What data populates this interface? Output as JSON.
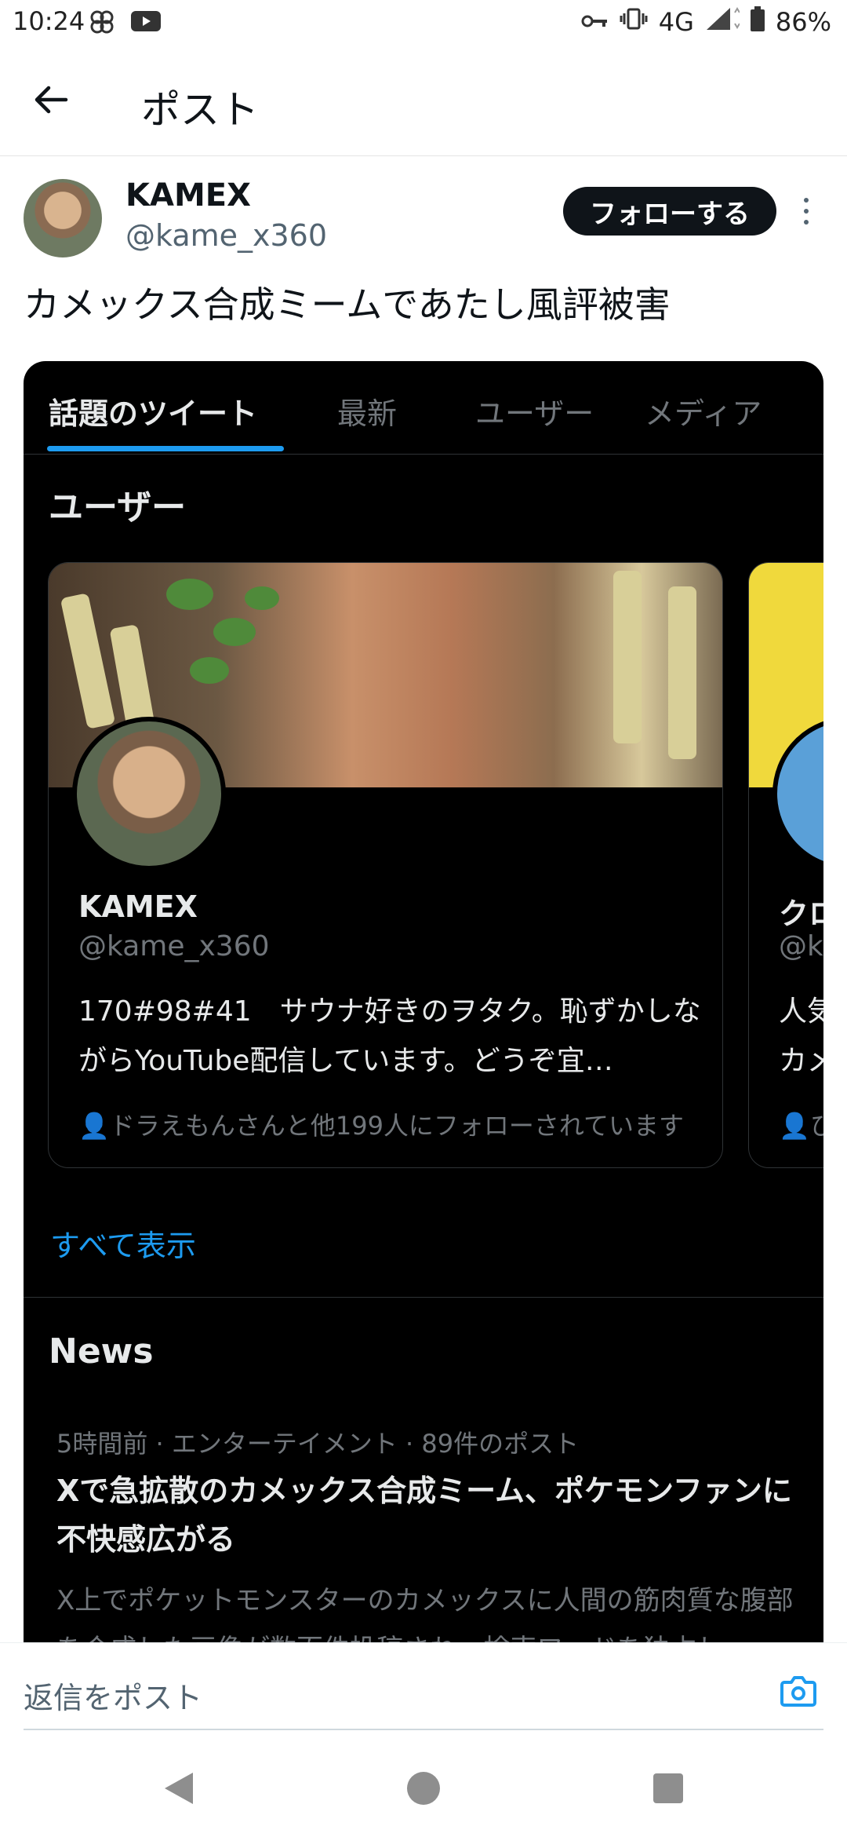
{
  "status_bar": {
    "time": "10:24",
    "network": "4G",
    "battery": "86%"
  },
  "header": {
    "title": "ポスト"
  },
  "post": {
    "author_name": "KAMEX",
    "author_handle": "@kame_x360",
    "follow_label": "フォローする",
    "text": "カメックス合成ミームであたし風評被害"
  },
  "embed": {
    "tabs": [
      {
        "label": "話題のツイート",
        "active": true
      },
      {
        "label": "最新",
        "active": false
      },
      {
        "label": "ユーザー",
        "active": false
      },
      {
        "label": "メディア",
        "active": false
      }
    ],
    "users_heading": "ユーザー",
    "user_card": {
      "name": "KAMEX",
      "handle": "@kame_x360",
      "bio": "170#98#41　サウナ好きのヲタク。恥ずかしながらYouTube配信しています。どうぞ宜…",
      "followed_by": "ドラえもんさんと他199人にフォローされています"
    },
    "partial_card": {
      "name": "クロ",
      "handle": "@ka",
      "bio_line1": "人気",
      "bio_line2": "カメ",
      "followed_by": "ひ"
    },
    "show_all": "すべて表示",
    "news_heading": "News",
    "news_item": {
      "meta": "5時間前 · エンターテイメント · 89件のポスト",
      "headline": "Xで急拡散のカメックス合成ミーム、ポケモンファンに不快感広がる",
      "summary": "X上でポケットモンスターのカメックスに人間の筋肉質な腹部を合成した画像が数百件投稿され、検索ワードを独占し"
    }
  },
  "reply_bar": {
    "placeholder": "返信をポスト"
  },
  "colors": {
    "accent": "#1d9bf0",
    "dark_bg": "#000000",
    "text": "#0f1419"
  }
}
